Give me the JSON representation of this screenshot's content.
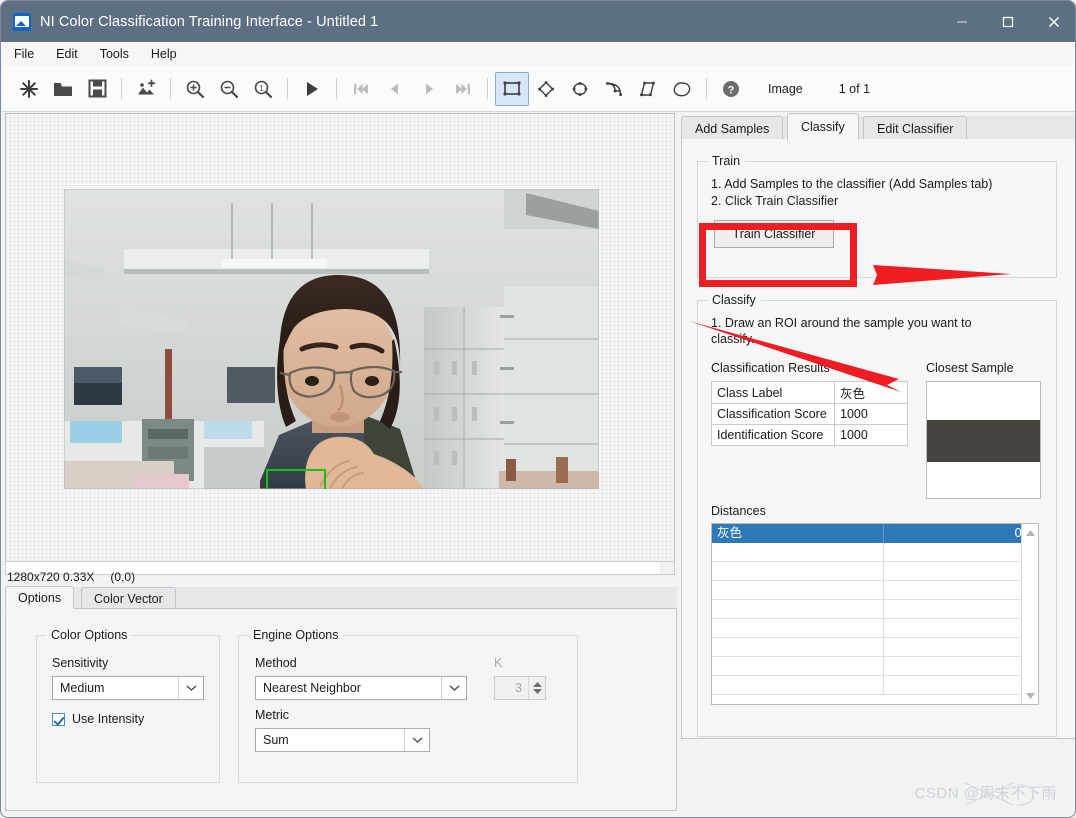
{
  "window": {
    "title": "NI Color Classification Training Interface - Untitled 1",
    "app_icon": "image-icon",
    "minimize": "minimize-icon",
    "maximize": "maximize-icon",
    "close": "close-icon"
  },
  "menubar": {
    "items": [
      {
        "label": "File"
      },
      {
        "label": "Edit"
      },
      {
        "label": "Tools"
      },
      {
        "label": "Help"
      }
    ]
  },
  "toolbar": {
    "buttons": [
      {
        "name": "new-icon"
      },
      {
        "name": "open-folder-icon"
      },
      {
        "name": "save-icon"
      },
      {
        "name": "add-image-icon"
      },
      {
        "name": "zoom-in-icon"
      },
      {
        "name": "zoom-out-icon"
      },
      {
        "name": "zoom-actual-icon"
      },
      {
        "name": "play-icon"
      },
      {
        "name": "first-image-icon"
      },
      {
        "name": "previous-image-icon"
      },
      {
        "name": "next-image-icon"
      },
      {
        "name": "last-image-icon"
      },
      {
        "name": "rectangle-roi-icon"
      },
      {
        "name": "rotated-rect-roi-icon"
      },
      {
        "name": "oval-roi-icon"
      },
      {
        "name": "annulus-roi-icon"
      },
      {
        "name": "polygon-roi-icon"
      },
      {
        "name": "freehand-roi-icon"
      },
      {
        "name": "help-icon"
      }
    ],
    "image_label": "Image",
    "image_count": "1 of  1"
  },
  "image_pane": {
    "status_size": "1280x720 0.33X",
    "status_coords": "(0,0)",
    "roi_color": "#17c017"
  },
  "bottom_tabs": {
    "tabs": [
      {
        "label": "Options",
        "active": true
      },
      {
        "label": "Color Vector",
        "active": false
      }
    ],
    "color_options": {
      "group_title": "Color Options",
      "sensitivity_label": "Sensitivity",
      "sensitivity_value": "Medium",
      "use_intensity_label": "Use Intensity",
      "use_intensity_checked": true
    },
    "engine_options": {
      "group_title": "Engine Options",
      "method_label": "Method",
      "method_value": "Nearest Neighbor",
      "k_label": "K",
      "k_value": "3",
      "metric_label": "Metric",
      "metric_value": "Sum"
    }
  },
  "right_panel": {
    "tabs": [
      {
        "label": "Add Samples",
        "active": false
      },
      {
        "label": "Classify",
        "active": true
      },
      {
        "label": "Edit Classifier",
        "active": false
      }
    ],
    "train": {
      "group_title": "Train",
      "step1": "1. Add Samples to the classifier (Add Samples tab)",
      "step2": "2. Click Train Classifier",
      "button_label": "Train Classifier"
    },
    "classify": {
      "group_title": "Classify",
      "step1": "1. Draw an ROI around the sample you want to",
      "step1_cont": "classify.",
      "results_label": "Classification Results",
      "results_rows": [
        {
          "key": "Class Label",
          "value": "灰色"
        },
        {
          "key": "Classification Score",
          "value": "1000"
        },
        {
          "key": "Identification Score",
          "value": "1000"
        }
      ],
      "closest_sample_label": "Closest Sample",
      "closest_sample_color": "#474440"
    },
    "distances": {
      "label": "Distances",
      "rows": [
        {
          "name": "灰色",
          "value": "0.0",
          "selected": true
        },
        {
          "name": "",
          "value": "",
          "selected": false
        },
        {
          "name": "",
          "value": "",
          "selected": false
        },
        {
          "name": "",
          "value": "",
          "selected": false
        },
        {
          "name": "",
          "value": "",
          "selected": false
        },
        {
          "name": "",
          "value": "",
          "selected": false
        },
        {
          "name": "",
          "value": "",
          "selected": false
        },
        {
          "name": "",
          "value": "",
          "selected": false
        },
        {
          "name": "",
          "value": "",
          "selected": false
        }
      ],
      "scroll_up": "scroll-up-arrow-icon",
      "scroll_down": "scroll-down-arrow-icon",
      "selection_color": "#2e79b5"
    }
  },
  "annotations": {
    "highlight_color": "#ee1c23",
    "arrow1_target": "train-classifier-button",
    "arrow2_target": "classification-results"
  },
  "watermark": {
    "text": "CSDN @周末不下雨"
  }
}
